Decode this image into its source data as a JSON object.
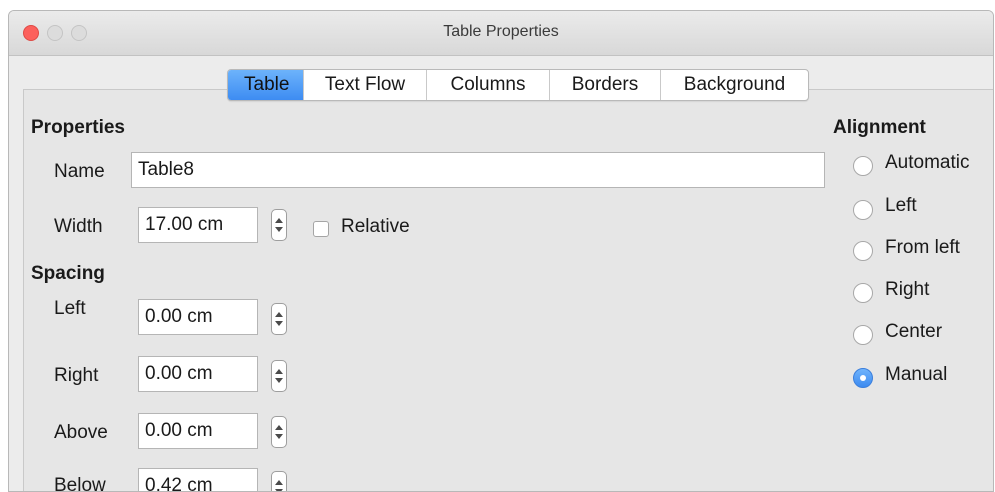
{
  "window": {
    "title": "Table Properties"
  },
  "tabs": [
    {
      "label": "Table",
      "active": true
    },
    {
      "label": "Text Flow",
      "active": false
    },
    {
      "label": "Columns",
      "active": false
    },
    {
      "label": "Borders",
      "active": false
    },
    {
      "label": "Background",
      "active": false
    }
  ],
  "properties": {
    "heading": "Properties",
    "name_label": "Name",
    "name_value": "Table8",
    "width_label": "Width",
    "width_value": "17.00 cm",
    "relative_label": "Relative",
    "relative_checked": false
  },
  "spacing": {
    "heading": "Spacing",
    "left_label": "Left",
    "left_value": "0.00 cm",
    "right_label": "Right",
    "right_value": "0.00 cm",
    "above_label": "Above",
    "above_value": "0.00 cm",
    "below_label": "Below",
    "below_value": "0.42 cm"
  },
  "alignment": {
    "heading": "Alignment",
    "options": [
      {
        "label": "Automatic",
        "selected": false
      },
      {
        "label": "Left",
        "selected": false
      },
      {
        "label": "From left",
        "selected": false
      },
      {
        "label": "Right",
        "selected": false
      },
      {
        "label": "Center",
        "selected": false
      },
      {
        "label": "Manual",
        "selected": true
      }
    ]
  },
  "colors": {
    "accent": "#3d8cf2",
    "close_button": "#fc605c",
    "dialog_bg": "#ececec"
  }
}
